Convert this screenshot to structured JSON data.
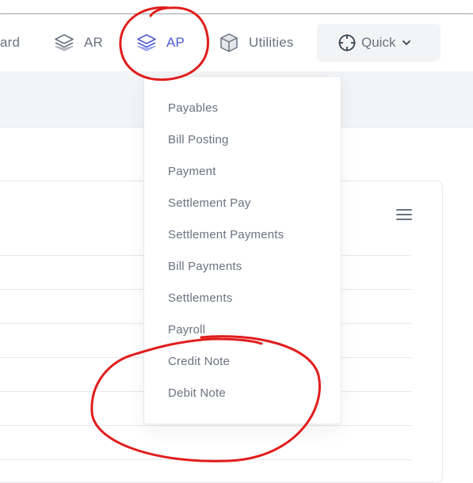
{
  "navbar": {
    "partial_item_label": "ard",
    "items": [
      {
        "label": "AR",
        "icon": "layers-icon"
      },
      {
        "label": "AP",
        "icon": "layers-icon",
        "active": true
      },
      {
        "label": "Utilities",
        "icon": "cube-icon"
      }
    ],
    "quick": {
      "label": "Quick",
      "icon": "crosshair-icon",
      "chevron": "chevron-down-icon"
    }
  },
  "dropdown": {
    "items": [
      "Payables",
      "Bill Posting",
      "Payment",
      "Settlement Pay",
      "Settlement Payments",
      "Bill Payments",
      "Settlements",
      "Payroll",
      "Credit Note",
      "Debit Note"
    ]
  },
  "card": {
    "menu_icon": "hamburger-icon"
  },
  "colors": {
    "accent": "#4f5bd5",
    "text": "#6b7280",
    "annotation": "#e11d1d"
  }
}
